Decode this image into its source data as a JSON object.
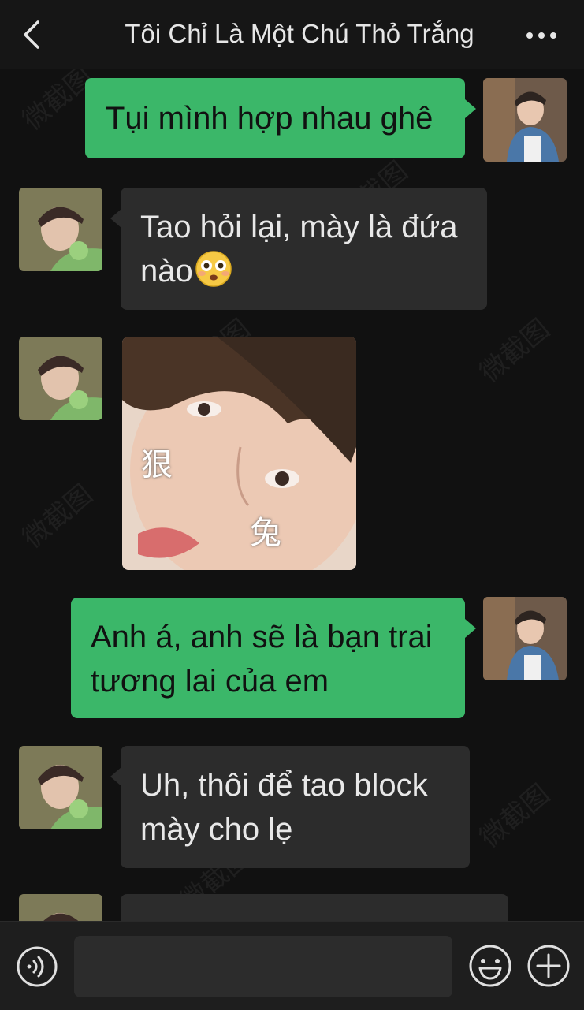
{
  "header": {
    "title": "Tôi Chỉ Là Một Chú Thỏ Trắng",
    "back_icon": "chevron-left-icon",
    "more_icon": "more-dots-icon"
  },
  "messages": [
    {
      "from": "me",
      "type": "text",
      "text": "Tụi mình hợp nhau ghê"
    },
    {
      "from": "them",
      "type": "text",
      "text_line1": "Tao hỏi lại, mày là đứa",
      "text_line2": "nào",
      "emoji": "flushed-face-emoji"
    },
    {
      "from": "them",
      "type": "sticker",
      "char1": "狠",
      "char2": "兔"
    },
    {
      "from": "me",
      "type": "text",
      "text_line1": "Anh á, anh sẽ là bạn trai",
      "text_line2": "tương lai của em"
    },
    {
      "from": "them",
      "type": "text",
      "text_line1": "Uh, thôi để tao block",
      "text_line2": "mày cho lẹ"
    },
    {
      "from": "them",
      "type": "text",
      "text": ""
    }
  ],
  "input_bar": {
    "voice_icon": "voice-icon",
    "text_value": "",
    "emoji_icon": "emoji-icon",
    "add_icon": "plus-circle-icon"
  },
  "watermark": "微截图",
  "colors": {
    "background": "#111111",
    "outgoing": "#3bb769",
    "incoming": "#2c2c2c"
  }
}
